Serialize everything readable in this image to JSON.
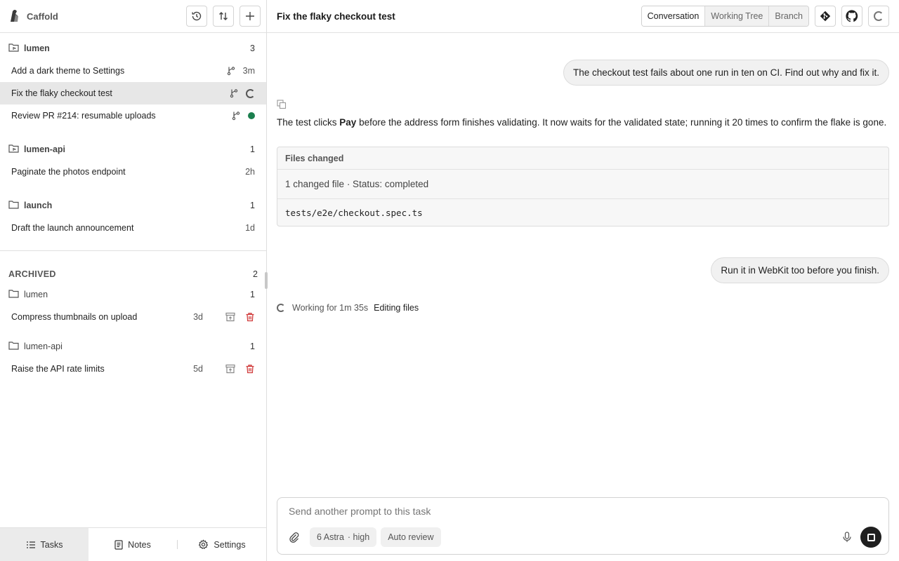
{
  "app": {
    "name": "Caffold"
  },
  "sidebar": {
    "groups": [
      {
        "name": "lumen",
        "count": "3",
        "tasks": [
          {
            "title": "Add a dark theme to Settings",
            "age": "3m",
            "status": "branch"
          },
          {
            "title": "Fix the flaky checkout test",
            "age": "",
            "status": "running",
            "selected": true
          },
          {
            "title": "Review PR #214: resumable uploads",
            "age": "",
            "status": "done"
          }
        ]
      },
      {
        "name": "lumen-api",
        "count": "1",
        "tasks": [
          {
            "title": "Paginate the photos endpoint",
            "age": "2h"
          }
        ]
      },
      {
        "name": "launch",
        "count": "1",
        "tasks": [
          {
            "title": "Draft the launch announcement",
            "age": "1d"
          }
        ]
      }
    ],
    "archived": {
      "label": "ARCHIVED",
      "count": "2",
      "groups": [
        {
          "name": "lumen",
          "count": "1",
          "tasks": [
            {
              "title": "Compress thumbnails on upload",
              "age": "3d"
            }
          ]
        },
        {
          "name": "lumen-api",
          "count": "1",
          "tasks": [
            {
              "title": "Raise the API rate limits",
              "age": "5d"
            }
          ]
        }
      ]
    },
    "footer": {
      "tasks": "Tasks",
      "notes": "Notes",
      "settings": "Settings"
    }
  },
  "main": {
    "title": "Fix the flaky checkout test",
    "tabs": [
      "Conversation",
      "Working Tree",
      "Branch"
    ],
    "active_tab": "Conversation",
    "messages": {
      "user1": "The checkout test fails about one run in ten on CI. Find out why and fix it.",
      "assistant_pre": "The test clicks ",
      "assistant_bold": "Pay",
      "assistant_post": " before the address form finishes validating. It now waits for the validated state; running it 20 times to confirm the flake is gone.",
      "user2": "Run it in WebKit too before you finish."
    },
    "files_changed": {
      "title": "Files changed",
      "summary": "1 changed file · Status: completed",
      "files": [
        "tests/e2e/checkout.spec.ts"
      ]
    },
    "working": {
      "time": "Working for 1m 35s",
      "state": "Editing files"
    },
    "composer": {
      "placeholder": "Send another prompt to this task",
      "model": "6 Astra",
      "effort": "· high",
      "auto_review": "Auto review"
    }
  },
  "colors": {
    "done_dot": "#1b7f4e",
    "selected_row": "#e7e7e7"
  }
}
